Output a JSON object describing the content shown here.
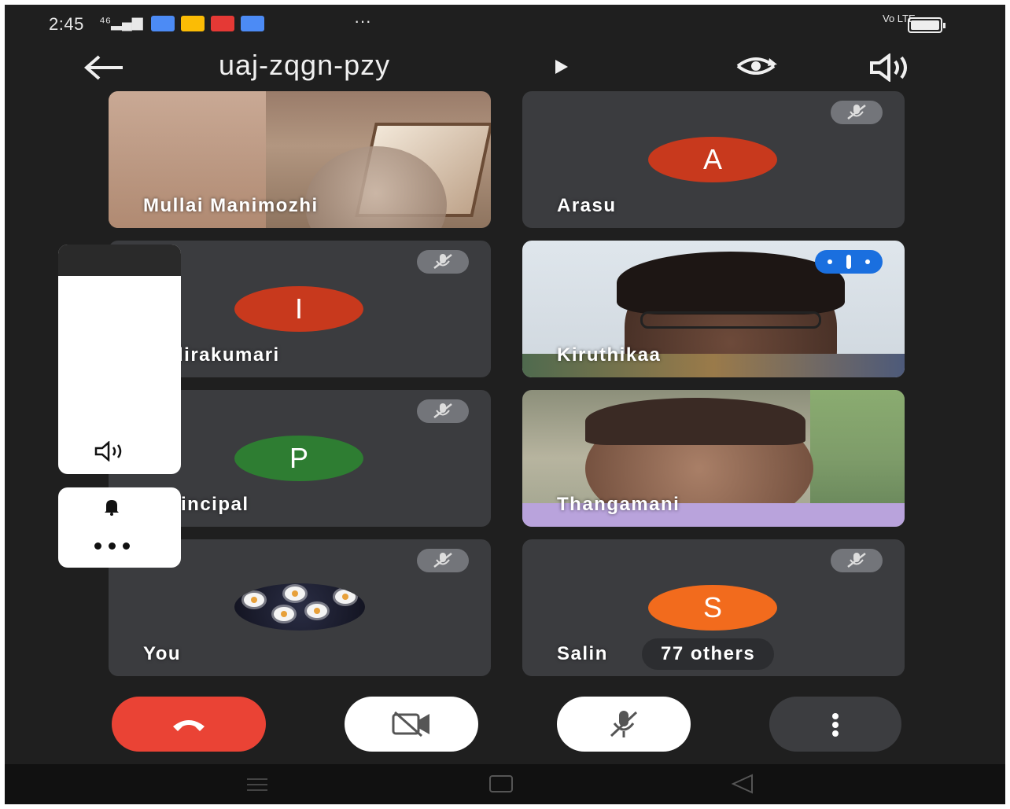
{
  "status_bar": {
    "time": "2:45",
    "network_indicator": "⁴⁶",
    "more_notifications": "···",
    "volte": "Vo LTE",
    "app_icon_colors": [
      "#4c8bf5",
      "#fbbc05",
      "#e53935",
      "#4c8bf5"
    ]
  },
  "header": {
    "meeting_code": "uaj-zqgn-pzy",
    "back_icon": "arrow-left-icon",
    "flip_camera_icon": "switch-camera-icon",
    "audio_icon": "speaker-icon"
  },
  "participants": [
    {
      "name": "Mullai Manimozhi",
      "type": "video",
      "muted": false
    },
    {
      "name": "Arasu",
      "type": "avatar",
      "initial": "A",
      "color": "#c8391d",
      "muted": true
    },
    {
      "name": "dirakumari",
      "type": "avatar",
      "initial": "I",
      "color": "#c8391d",
      "muted": true
    },
    {
      "name": "Kiruthikaa",
      "type": "video",
      "speaking": true
    },
    {
      "name": "incipal",
      "type": "avatar",
      "initial": "P",
      "color": "#2e7d32",
      "muted": true
    },
    {
      "name": "Thangamani",
      "type": "video",
      "muted": false
    },
    {
      "name": "You",
      "type": "photo-avatar",
      "muted": true
    },
    {
      "name": "Salin",
      "type": "avatar",
      "initial": "S",
      "color": "#f26b1d",
      "muted": true
    }
  ],
  "others_label": "77 others",
  "colors": {
    "background": "#1f1f1f",
    "tile": "#3b3c3f",
    "end_call": "#ea4335",
    "speaking_indicator": "#1a6fdf"
  }
}
